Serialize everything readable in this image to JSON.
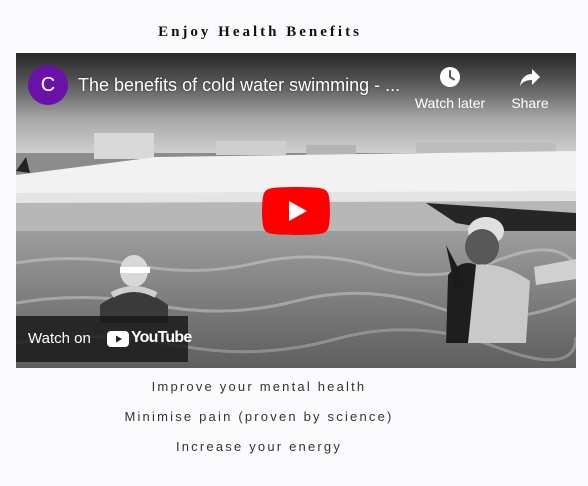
{
  "section": {
    "heading": "Enjoy Health Benefits"
  },
  "video": {
    "channel_initial": "C",
    "channel_avatar_color": "#6a11a8",
    "title": "The benefits of cold water swimming - ...",
    "watch_later_label": "Watch later",
    "share_label": "Share",
    "watch_on_label": "Watch on",
    "youtube_word": "YouTube",
    "play_button_color": "#ff0000",
    "watch_later_icon": "clock-icon",
    "share_icon": "share-arrow-icon",
    "play_icon": "play-icon"
  },
  "benefits": [
    "Improve your mental health",
    "Minimise pain (proven by science)",
    "Increase your energy"
  ]
}
